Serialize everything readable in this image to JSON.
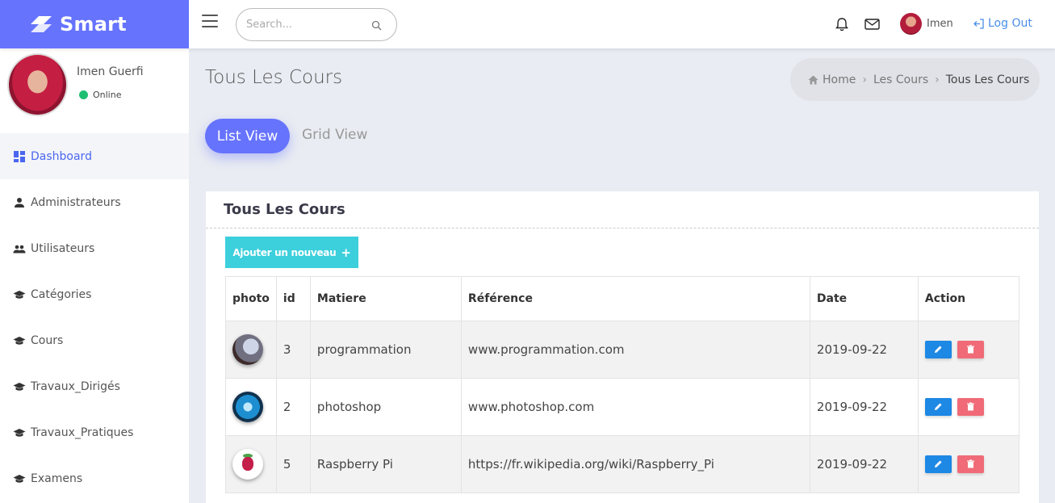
{
  "brand": {
    "name": "Smart"
  },
  "search": {
    "placeholder": "Search..."
  },
  "topbar": {
    "username": "Imen",
    "logout_label": "Log Out"
  },
  "profile": {
    "name": "Imen Guerfi",
    "status": "Online"
  },
  "sidebar": {
    "items": [
      {
        "label": "Dashboard",
        "icon": "dashboard-icon",
        "active": true
      },
      {
        "label": "Administrateurs",
        "icon": "person-icon"
      },
      {
        "label": "Utilisateurs",
        "icon": "people-icon"
      },
      {
        "label": "Catégories",
        "icon": "graduation-cap-icon"
      },
      {
        "label": "Cours",
        "icon": "graduation-cap-icon"
      },
      {
        "label": "Travaux_Dirigés",
        "icon": "graduation-cap-icon"
      },
      {
        "label": "Travaux_Pratiques",
        "icon": "graduation-cap-icon"
      },
      {
        "label": "Examens",
        "icon": "graduation-cap-icon"
      }
    ]
  },
  "page": {
    "title": "Tous Les Cours"
  },
  "breadcrumb": {
    "home": "Home",
    "section": "Les Cours",
    "current": "Tous Les Cours"
  },
  "view_toggle": {
    "list_label": "List View",
    "grid_label": "Grid View"
  },
  "card": {
    "title": "Tous Les Cours",
    "add_label": "Ajouter un nouveau",
    "add_symbol": "+"
  },
  "table": {
    "headers": [
      "photo",
      "id",
      "Matiere",
      "Référence",
      "Date",
      "Action"
    ],
    "rows": [
      {
        "id": "3",
        "matiere": "programmation",
        "reference": "www.programmation.com",
        "date": "2019-09-22"
      },
      {
        "id": "2",
        "matiere": "photoshop",
        "reference": "www.photoshop.com",
        "date": "2019-09-22"
      },
      {
        "id": "5",
        "matiere": "Raspberry Pi",
        "reference": "https://fr.wikipedia.org/wiki/Raspberry_Pi",
        "date": "2019-09-22"
      }
    ]
  },
  "colors": {
    "accent": "#6673fd",
    "add_button": "#3ccfdc",
    "edit_button": "#1e88e5",
    "delete_button": "#f06b77",
    "online": "#1fbf73",
    "link": "#4a8ee6"
  }
}
